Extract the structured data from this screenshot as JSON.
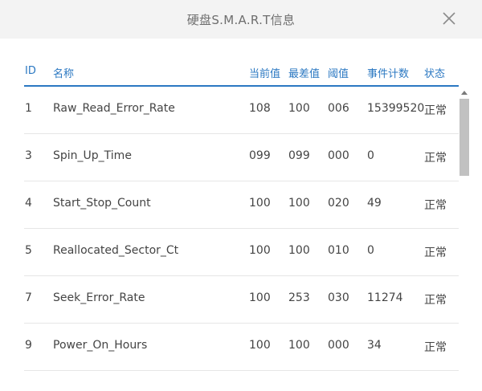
{
  "dialog": {
    "title": "硬盘S.M.A.R.T信息",
    "close_icon": "close-icon"
  },
  "table": {
    "headers": {
      "id": "ID",
      "name": "名称",
      "current": "当前值",
      "worst": "最差值",
      "threshold": "阈值",
      "raw": "事件计数",
      "status": "状态"
    },
    "rows": [
      {
        "id": "1",
        "name": "Raw_Read_Error_Rate",
        "current": "108",
        "worst": "100",
        "threshold": "006",
        "raw": "15399520",
        "status": "正常"
      },
      {
        "id": "3",
        "name": "Spin_Up_Time",
        "current": "099",
        "worst": "099",
        "threshold": "000",
        "raw": "0",
        "status": "正常"
      },
      {
        "id": "4",
        "name": "Start_Stop_Count",
        "current": "100",
        "worst": "100",
        "threshold": "020",
        "raw": "49",
        "status": "正常"
      },
      {
        "id": "5",
        "name": "Reallocated_Sector_Ct",
        "current": "100",
        "worst": "100",
        "threshold": "010",
        "raw": "0",
        "status": "正常"
      },
      {
        "id": "7",
        "name": "Seek_Error_Rate",
        "current": "100",
        "worst": "253",
        "threshold": "030",
        "raw": "11274",
        "status": "正常"
      },
      {
        "id": "9",
        "name": "Power_On_Hours",
        "current": "100",
        "worst": "100",
        "threshold": "000",
        "raw": "34",
        "status": "正常"
      }
    ]
  },
  "colors": {
    "accent": "#2b78c2",
    "title_text": "#6e6e6e",
    "body_text": "#444444"
  }
}
